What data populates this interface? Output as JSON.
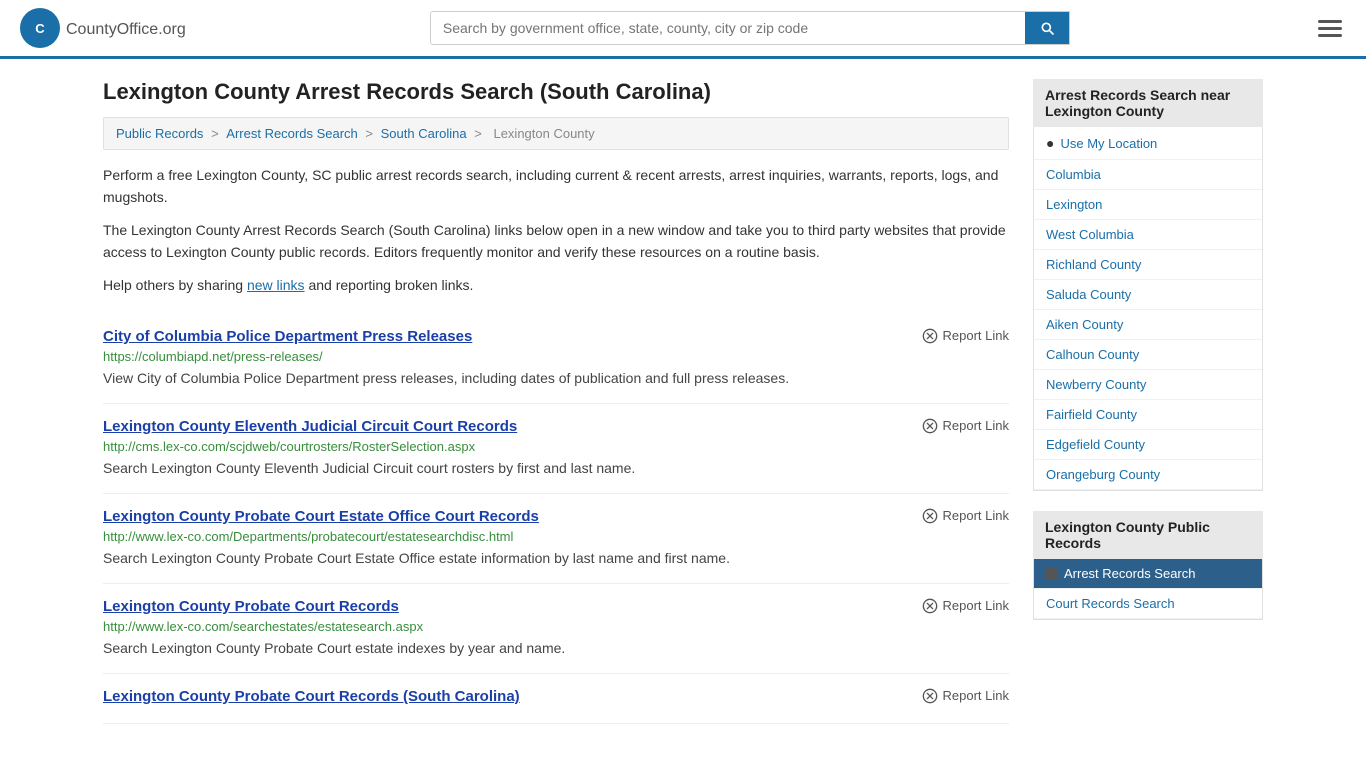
{
  "header": {
    "logo_text": "CountyOffice",
    "logo_suffix": ".org",
    "search_placeholder": "Search by government office, state, county, city or zip code",
    "search_value": ""
  },
  "page": {
    "title": "Lexington County Arrest Records Search (South Carolina)",
    "description1": "Perform a free Lexington County, SC public arrest records search, including current & recent arrests, arrest inquiries, warrants, reports, logs, and mugshots.",
    "description2": "The Lexington County Arrest Records Search (South Carolina) links below open in a new window and take you to third party websites that provide access to Lexington County public records. Editors frequently monitor and verify these resources on a routine basis.",
    "help_text_prefix": "Help others by sharing ",
    "help_link": "new links",
    "help_text_suffix": " and reporting broken links."
  },
  "breadcrumb": {
    "items": [
      "Public Records",
      "Arrest Records Search",
      "South Carolina",
      "Lexington County"
    ],
    "separators": [
      ">",
      ">",
      ">"
    ]
  },
  "records": [
    {
      "title": "City of Columbia Police Department Press Releases",
      "url": "https://columbiapd.net/press-releases/",
      "description": "View City of Columbia Police Department press releases, including dates of publication and full press releases.",
      "report_label": "Report Link"
    },
    {
      "title": "Lexington County Eleventh Judicial Circuit Court Records",
      "url": "http://cms.lex-co.com/scjdweb/courtrosters/RosterSelection.aspx",
      "description": "Search Lexington County Eleventh Judicial Circuit court rosters by first and last name.",
      "report_label": "Report Link"
    },
    {
      "title": "Lexington County Probate Court Estate Office Court Records",
      "url": "http://www.lex-co.com/Departments/probatecourt/estatesearchdisc.html",
      "description": "Search Lexington County Probate Court Estate Office estate information by last name and first name.",
      "report_label": "Report Link"
    },
    {
      "title": "Lexington County Probate Court Records",
      "url": "http://www.lex-co.com/searchestates/estatesearch.aspx",
      "description": "Search Lexington County Probate Court estate indexes by year and name.",
      "report_label": "Report Link"
    },
    {
      "title": "Lexington County Probate Court Records (South Carolina)",
      "url": "",
      "description": "",
      "report_label": "Report Link"
    }
  ],
  "sidebar": {
    "nearby_title": "Arrest Records Search near Lexington County",
    "use_location_label": "Use My Location",
    "nearby_items": [
      "Columbia",
      "Lexington",
      "West Columbia",
      "Richland County",
      "Saluda County",
      "Aiken County",
      "Calhoun County",
      "Newberry County",
      "Fairfield County",
      "Edgefield County",
      "Orangeburg County"
    ],
    "public_records_title": "Lexington County Public Records",
    "public_records_items": [
      {
        "label": "Arrest Records Search",
        "active": true
      },
      {
        "label": "Court Records Search",
        "active": false
      }
    ]
  }
}
